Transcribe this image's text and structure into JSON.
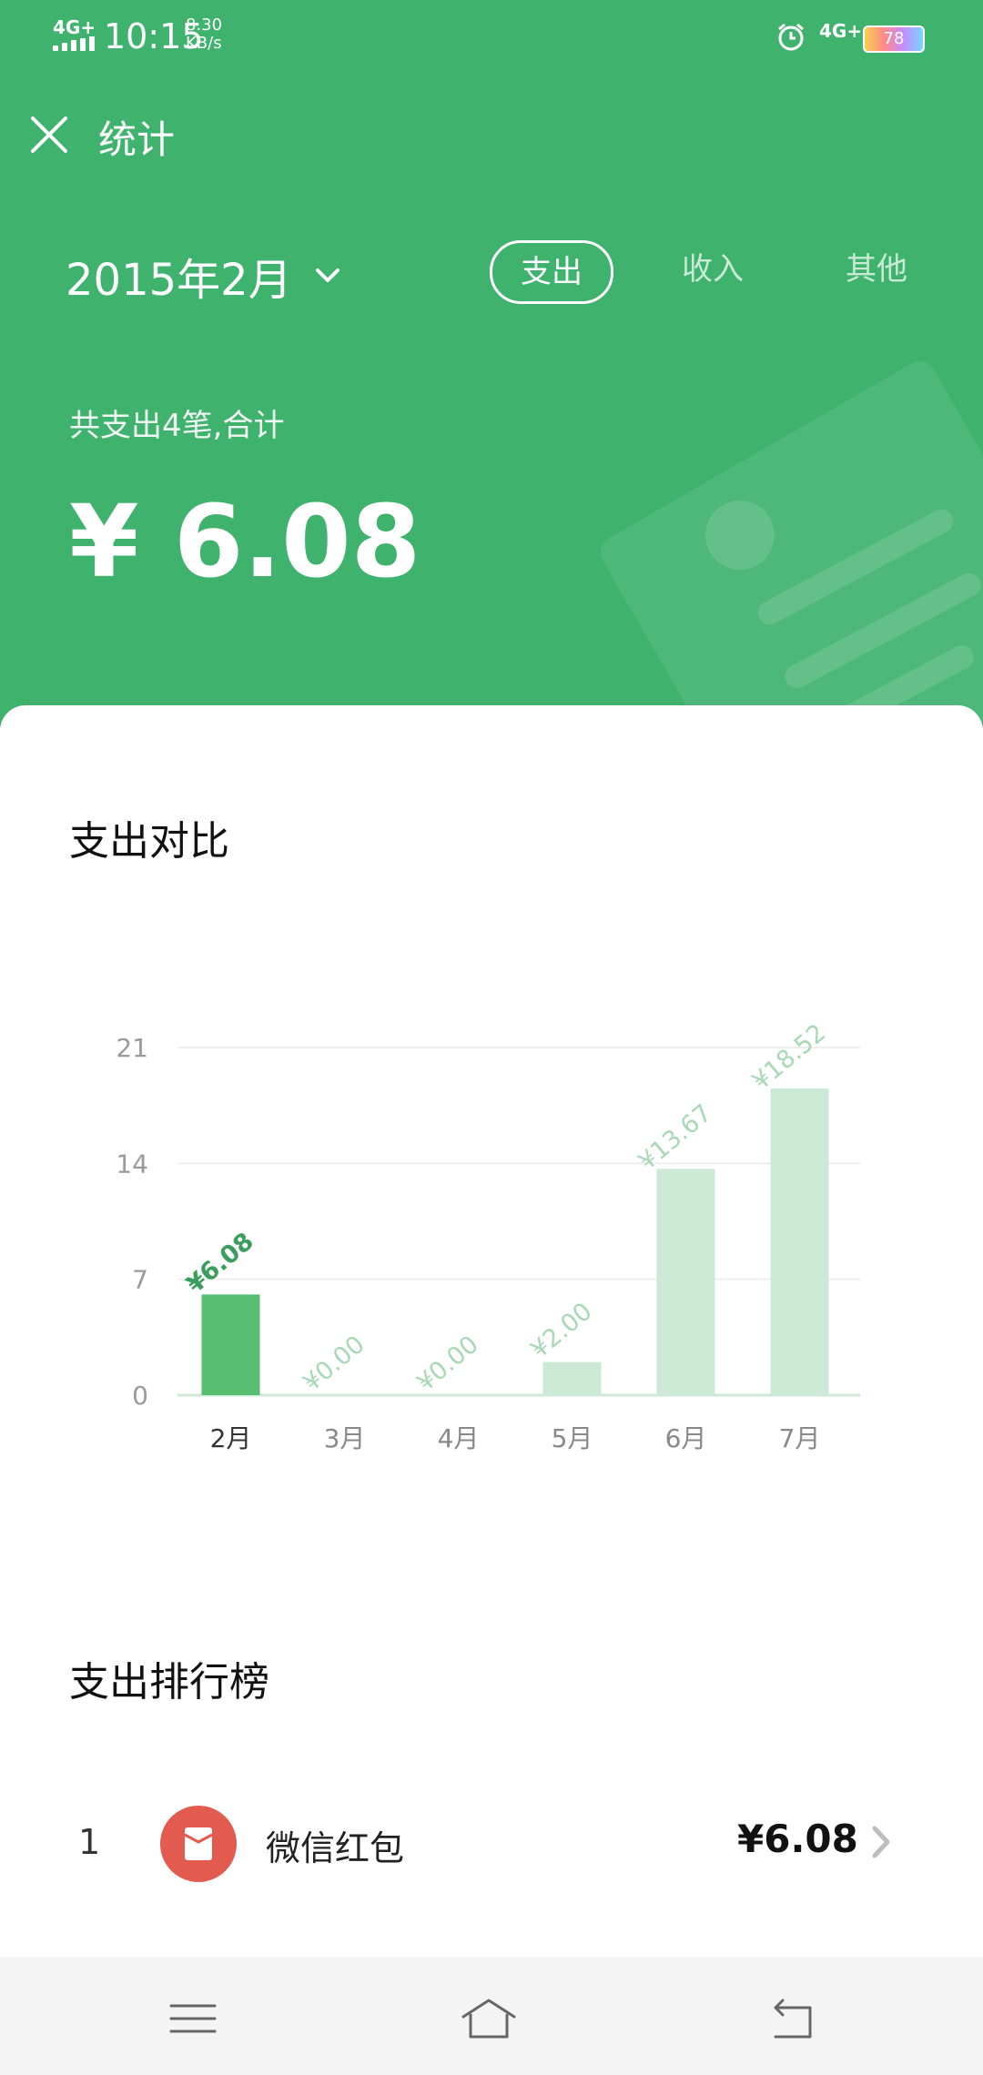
{
  "status_bar": {
    "network": "4G+",
    "time": "10:15",
    "speed_value": "8.30",
    "speed_unit": "KB/s",
    "network_right": "4G+",
    "battery": "78",
    "icons": [
      "alarm-icon",
      "signal-icon",
      "battery-icon"
    ]
  },
  "header": {
    "close_icon": "close-icon",
    "title": "统计",
    "date_label": "2015年2月",
    "date_icon": "chevron-down-icon",
    "tabs": [
      {
        "label": "支出",
        "active": true
      },
      {
        "label": "收入",
        "active": false
      },
      {
        "label": "其他",
        "active": false
      }
    ],
    "summary": "共支出4笔,合计",
    "total": "¥ 6.08",
    "background_color": "#3fb26d"
  },
  "comparison": {
    "title": "支出对比"
  },
  "chart_data": {
    "type": "bar",
    "categories": [
      "2月",
      "3月",
      "4月",
      "5月",
      "6月",
      "7月"
    ],
    "values": [
      6.08,
      0.0,
      0.0,
      2.0,
      13.67,
      18.52
    ],
    "value_labels": [
      "¥6.08",
      "¥0.00",
      "¥0.00",
      "¥2.00",
      "¥13.67",
      "¥18.52"
    ],
    "yticks": [
      0,
      7,
      14,
      21
    ],
    "ylim": [
      0,
      21
    ],
    "highlight_index": 0,
    "colors": {
      "highlight": "#57bd70",
      "normal": "#cbe9d4",
      "label_highlight": "#3b9d5c",
      "label_normal": "#a8d8b6",
      "grid": "#eeeeee",
      "tick": "#9a9a9a"
    },
    "grid": true
  },
  "ranking": {
    "title": "支出排行榜",
    "items": [
      {
        "rank": "1",
        "name": "微信红包",
        "amount": "¥6.08",
        "icon": "red-envelope-icon",
        "arrow_icon": "chevron-right-icon"
      }
    ]
  },
  "nav_bar": {
    "icons": [
      "menu-icon",
      "home-icon",
      "back-icon"
    ]
  }
}
